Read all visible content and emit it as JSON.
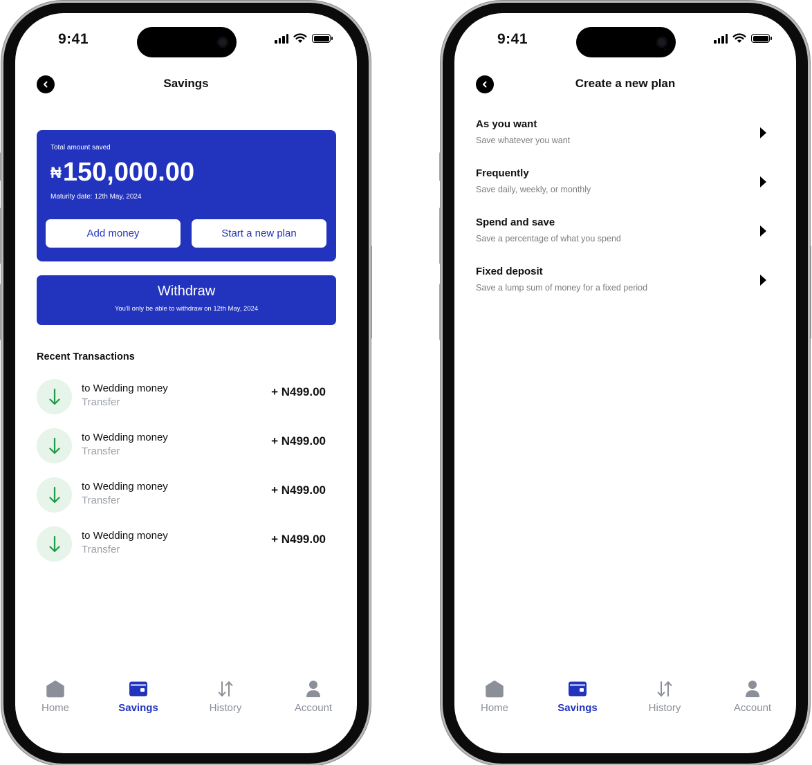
{
  "status": {
    "time": "9:41"
  },
  "savings_screen": {
    "title": "Savings",
    "card": {
      "label": "Total amount saved",
      "currency_symbol": "₦",
      "amount": "150,000.00",
      "maturity": "Maturity date: 12th May, 2024",
      "add_money": "Add money",
      "start_plan": "Start a new plan"
    },
    "withdraw": {
      "label": "Withdraw",
      "note": "You'll only be able to withdraw on 12th May, 2024"
    },
    "recent_title": "Recent Transactions",
    "transactions": [
      {
        "name": "to Wedding money",
        "type": "Transfer",
        "amount": "+ N499.00"
      },
      {
        "name": "to Wedding money",
        "type": "Transfer",
        "amount": "+ N499.00"
      },
      {
        "name": "to Wedding money",
        "type": "Transfer",
        "amount": "+ N499.00"
      },
      {
        "name": "to Wedding money",
        "type": "Transfer",
        "amount": "+ N499.00"
      }
    ]
  },
  "plan_screen": {
    "title": "Create a new plan",
    "options": [
      {
        "title": "As you want",
        "subtitle": "Save whatever you want"
      },
      {
        "title": "Frequently",
        "subtitle": "Save daily, weekly, or monthly"
      },
      {
        "title": "Spend and save",
        "subtitle": "Save a percentage of what you spend"
      },
      {
        "title": "Fixed deposit",
        "subtitle": "Save a lump sum of money for a fixed period"
      }
    ]
  },
  "tabbar": {
    "items": [
      {
        "label": "Home",
        "icon": "home-icon"
      },
      {
        "label": "Savings",
        "icon": "wallet-icon"
      },
      {
        "label": "History",
        "icon": "history-arrows-icon"
      },
      {
        "label": "Account",
        "icon": "user-icon"
      }
    ],
    "active": "Savings"
  },
  "colors": {
    "brand_blue": "#2233be",
    "credit_green": "#1f9a46",
    "credit_green_bg": "#e6f4ea",
    "inactive_tab": "#8a8f98"
  }
}
